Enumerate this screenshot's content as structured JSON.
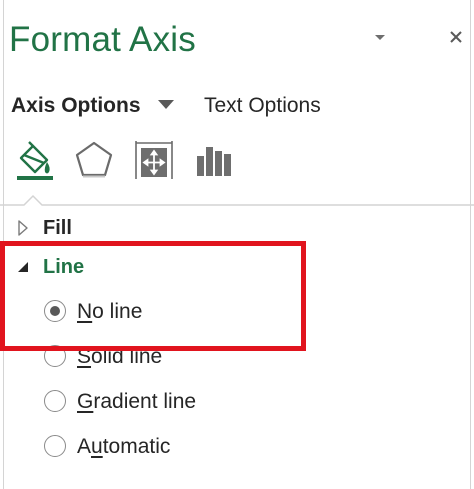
{
  "pane": {
    "title": "Format Axis",
    "dropdown_icon": "triangle-down-icon",
    "close_label": "×"
  },
  "tabs": {
    "axis_options": "Axis Options",
    "text_options": "Text Options"
  },
  "icon_row": [
    "fill-and-line-icon",
    "effects-pentagon-icon",
    "size-and-properties-icon",
    "axis-options-bar-chart-icon"
  ],
  "sections": {
    "fill": {
      "label": "Fill",
      "expanded": false
    },
    "line": {
      "label": "Line",
      "expanded": true,
      "options": [
        {
          "pre": "",
          "mnemonic": "N",
          "post": "o line",
          "checked": true
        },
        {
          "pre": "",
          "mnemonic": "S",
          "post": "olid line",
          "checked": false
        },
        {
          "pre": "",
          "mnemonic": "G",
          "post": "radient line",
          "checked": false
        },
        {
          "pre": "A",
          "mnemonic": "u",
          "post": "tomatic",
          "checked": false
        }
      ]
    }
  },
  "colors": {
    "accent_green": "#217346",
    "highlight_red": "#e1141e",
    "text": "#262626"
  }
}
